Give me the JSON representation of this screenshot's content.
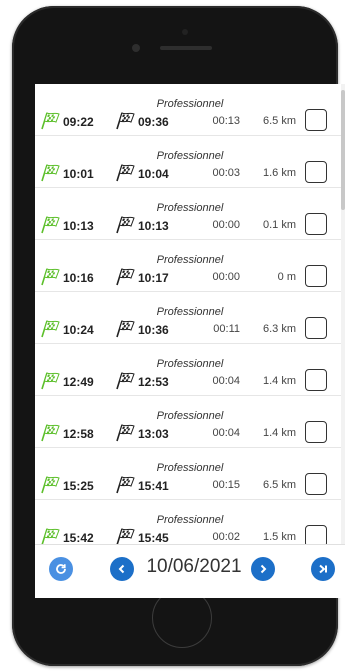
{
  "colors": {
    "flag_start": "#5cbf2a",
    "accent": "#1c6fc8",
    "refresh": "#4a90e2"
  },
  "icons": {
    "start": "green-checkered-flag-icon",
    "end": "checkered-flag-icon",
    "refresh": "refresh-icon",
    "prev": "chevron-left-icon",
    "next": "chevron-right-icon",
    "last": "skip-to-end-icon"
  },
  "trips": [
    {
      "type": "Professionnel",
      "start": "09:22",
      "end": "09:36",
      "duration": "00:13",
      "distance": "6.5 km",
      "checked": false
    },
    {
      "type": "Professionnel",
      "start": "10:01",
      "end": "10:04",
      "duration": "00:03",
      "distance": "1.6 km",
      "checked": false
    },
    {
      "type": "Professionnel",
      "start": "10:13",
      "end": "10:13",
      "duration": "00:00",
      "distance": "0.1 km",
      "checked": false
    },
    {
      "type": "Professionnel",
      "start": "10:16",
      "end": "10:17",
      "duration": "00:00",
      "distance": "0 m",
      "checked": false
    },
    {
      "type": "Professionnel",
      "start": "10:24",
      "end": "10:36",
      "duration": "00:11",
      "distance": "6.3 km",
      "checked": false
    },
    {
      "type": "Professionnel",
      "start": "12:49",
      "end": "12:53",
      "duration": "00:04",
      "distance": "1.4 km",
      "checked": false
    },
    {
      "type": "Professionnel",
      "start": "12:58",
      "end": "13:03",
      "duration": "00:04",
      "distance": "1.4 km",
      "checked": false
    },
    {
      "type": "Professionnel",
      "start": "15:25",
      "end": "15:41",
      "duration": "00:15",
      "distance": "6.5 km",
      "checked": false
    },
    {
      "type": "Professionnel",
      "start": "15:42",
      "end": "15:45",
      "duration": "00:02",
      "distance": "1.5 km",
      "checked": false
    }
  ],
  "footer": {
    "date": "10/06/2021"
  }
}
